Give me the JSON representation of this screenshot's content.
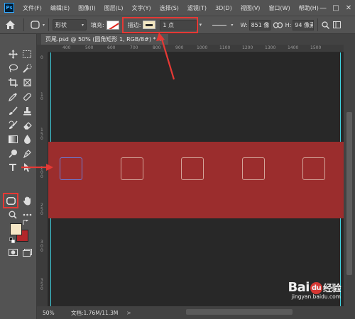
{
  "app": {
    "logo": "Ps"
  },
  "menu": [
    "文件(F)",
    "编辑(E)",
    "图像(I)",
    "图层(L)",
    "文字(Y)",
    "选择(S)",
    "滤镜(T)",
    "3D(D)",
    "视图(V)",
    "窗口(W)",
    "帮助(H)"
  ],
  "window_controls": [
    "—",
    "□",
    "✕"
  ],
  "options_bar": {
    "mode": "形状",
    "fill_label": "填充:",
    "stroke_label": "描边:",
    "stroke_width": "1 点",
    "w_label": "W:",
    "w_value": "851 像",
    "h_label": "H:",
    "h_value": "94 像素",
    "stroke_color": "#f3e7c1",
    "fill_none_color": "#e0261e"
  },
  "document": {
    "tab_title": "页尾.psd @ 50% (圆角矩形 1, RGB/8#) *",
    "close": "×"
  },
  "ruler": {
    "top_ticks": [
      "400",
      "500",
      "600",
      "700",
      "800",
      "900",
      "1000",
      "1100",
      "1200",
      "1300",
      "1400",
      "1500"
    ],
    "left_ticks": [
      "0",
      "1",
      "0",
      "1",
      "5",
      "0",
      "2",
      "0",
      "0",
      "2",
      "5",
      "0",
      "3",
      "0",
      "0",
      "3",
      "5",
      "0"
    ]
  },
  "canvas": {
    "background": "#282828",
    "band_color": "#9b2d2d",
    "guide_color": "#3fd1e0"
  },
  "colors": {
    "foreground": "#f6e7c6",
    "background": "#b2272a",
    "highlight": "#e53935"
  },
  "status": {
    "zoom": "50%",
    "doc_info": "文档:1.76M/11.3M",
    "arrow": ">"
  },
  "watermark": {
    "main_left": "Bai",
    "main_right": "经验",
    "paw": "du",
    "sub": "jingyan.baidu.com"
  }
}
